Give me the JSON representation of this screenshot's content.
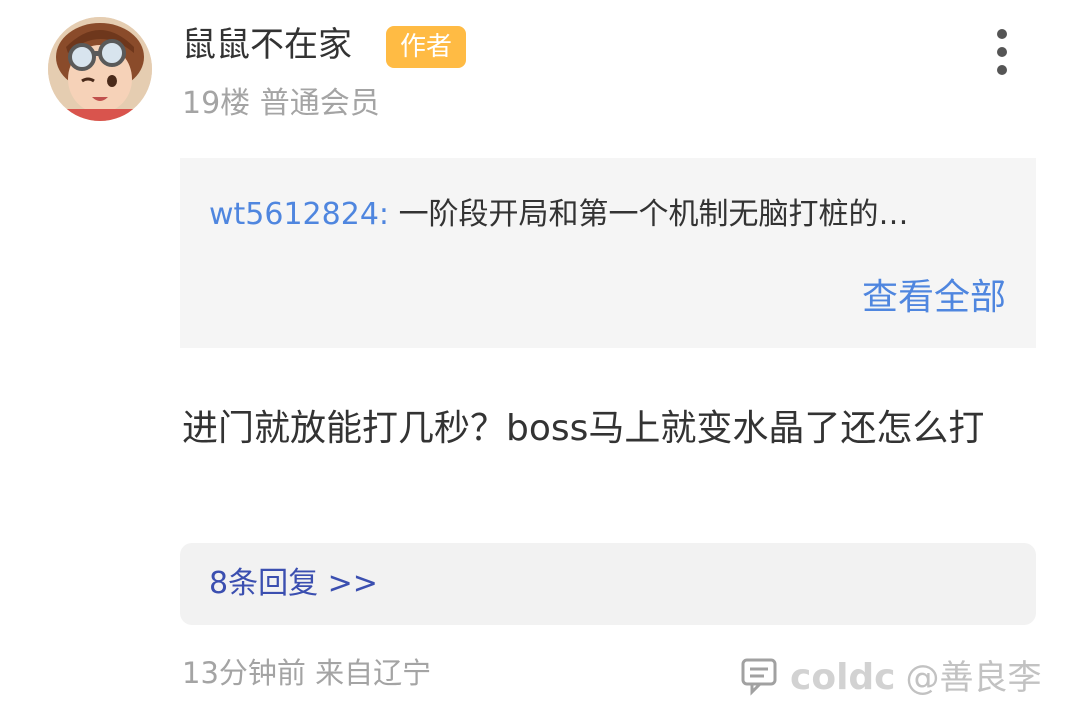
{
  "post": {
    "username": "鼠鼠不在家",
    "badge": "作者",
    "floor": "19楼",
    "member_level": "普通会员",
    "quote": {
      "user": "wt5612824:",
      "text": "一阶段开局和第一个机制无脑打桩的…",
      "view_all": "查看全部"
    },
    "content": "进门就放能打几秒？boss马上就变水晶了还怎么打",
    "replies_label": "8条回复 >>",
    "time_location": "13分钟前 来自辽宁"
  },
  "watermark": {
    "brand": "coldc",
    "handle": "@善良李"
  },
  "icons": {
    "more": "more-vertical-icon",
    "comment": "comment-icon"
  },
  "colors": {
    "badge": "#ffbb44",
    "link": "#4f86df",
    "replies": "#3b4fb0",
    "muted": "#a4a4a4"
  }
}
